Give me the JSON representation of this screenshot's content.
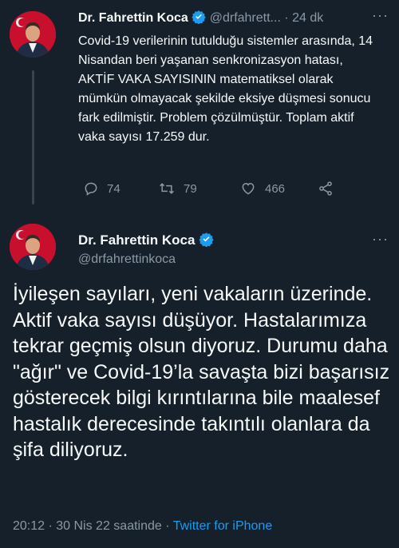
{
  "tweet1": {
    "author_name": "Dr. Fahrettin Koca",
    "handle": "@drfahrett...",
    "time": "24 dk",
    "text": "Covid-19 verilerinin tutulduğu sistemler arasında, 14 Nisandan beri yaşanan senkronizasyon hatası, AKTİF VAKA SAYISININ matematiksel olarak mümkün olmayacak şekilde eksiye düşmesi sonucu fark edilmiştir. Problem çözülmüştür. Toplam aktif vaka sayısı 17.259 dur.",
    "replies": "74",
    "retweets": "79",
    "likes": "466"
  },
  "tweet2": {
    "author_name": "Dr. Fahrettin Koca",
    "handle": "@drfahrettinkoca",
    "text": "İyileşen sayıları, yeni vakaların üzerinde. Aktif vaka sayısı düşüyor. Hastalarımıza tekrar geçmiş olsun diyoruz. Durumu daha \"ağır\" ve Covid-19’la savaşta bizi başarısız gösterecek bilgi kırıntılarına bile maalesef hastalık derecesinde takıntılı olanlara da şifa diliyoruz.",
    "timestamp": "20:12 · 30 Nis 22 saatinde ·",
    "source": "Twitter for iPhone"
  },
  "colors": {
    "background": "#15202b",
    "text": "#f7f9f9",
    "muted": "#8b98a5",
    "link": "#1d9bf0",
    "verified": "#1d9bf0"
  },
  "icons": [
    "reply-icon",
    "retweet-icon",
    "like-icon",
    "share-icon",
    "verified-badge-icon",
    "more-icon"
  ]
}
